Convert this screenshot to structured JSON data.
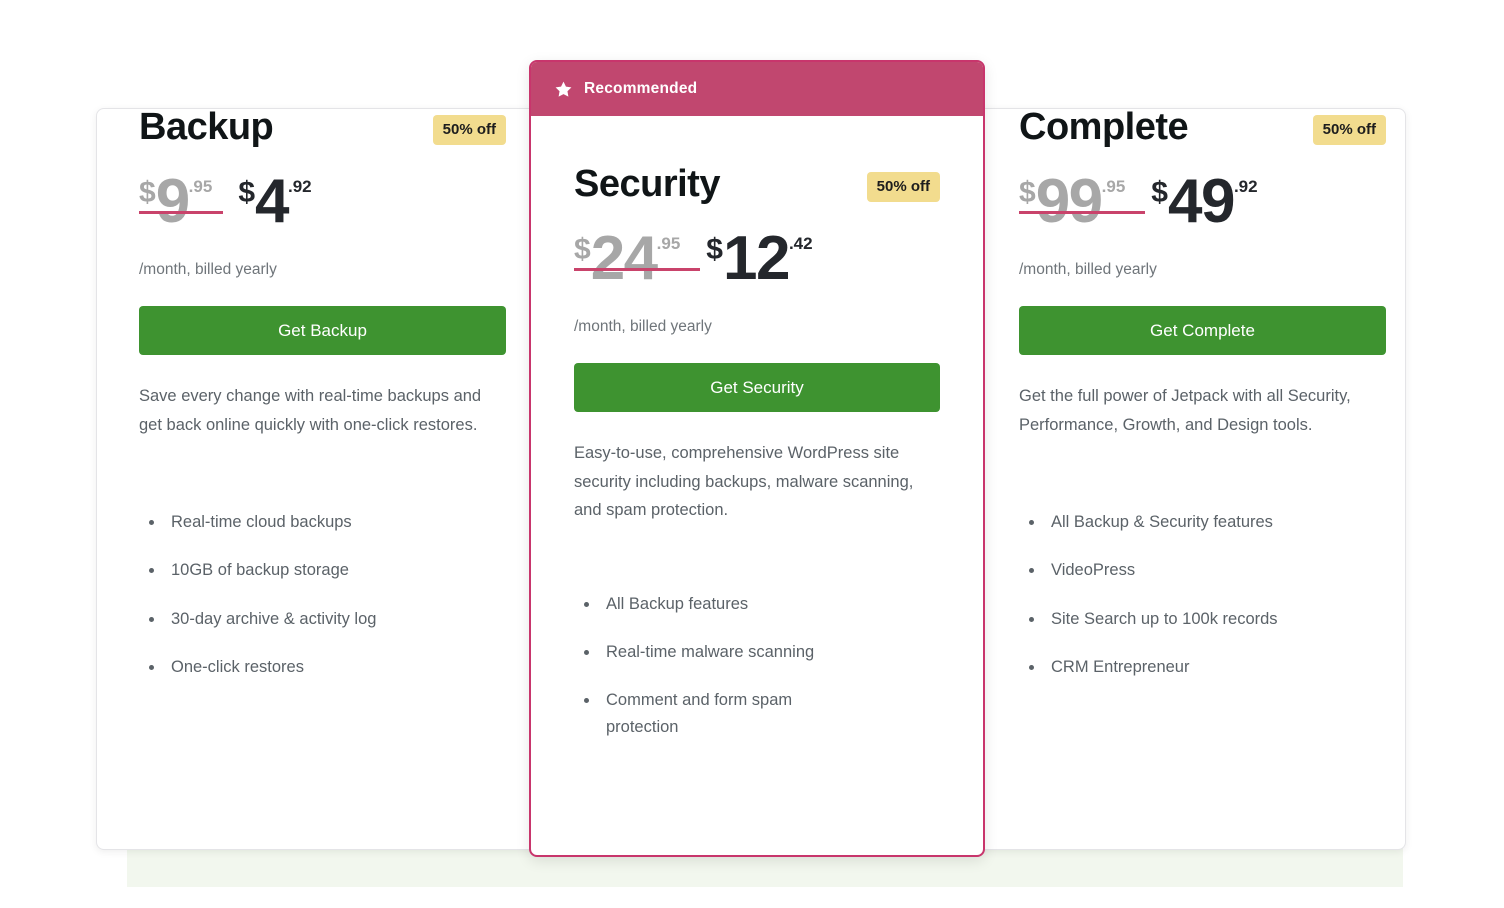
{
  "recommended_banner": {
    "label": "Recommended",
    "icon": "star-icon",
    "background_color": "#c1476f"
  },
  "theme": {
    "cta_green": "#3e9330",
    "badge_yellow": "#f2dc8e",
    "highlight_crimson": "#c8356c",
    "strike_color": "#c9436b",
    "band_green": "#f2f7ee"
  },
  "plans": [
    {
      "name": "Backup",
      "discount_badge": "50% off",
      "old_price": {
        "currency": "$",
        "integer": "9",
        "cents": ".95"
      },
      "new_price": {
        "currency": "$",
        "integer": "4",
        "cents": ".92"
      },
      "billing_note": "/month, billed yearly",
      "cta_label": "Get Backup",
      "description": "Save every change with real-time backups and get back online quickly with one-click restores.",
      "features": [
        "Real-time cloud backups",
        "10GB of backup storage",
        "30-day archive & activity log",
        "One-click restores"
      ]
    },
    {
      "name": "Security",
      "discount_badge": "50% off",
      "old_price": {
        "currency": "$",
        "integer": "24",
        "cents": ".95"
      },
      "new_price": {
        "currency": "$",
        "integer": "12",
        "cents": ".42"
      },
      "billing_note": "/month, billed yearly",
      "cta_label": "Get Security",
      "description": "Easy-to-use, comprehensive WordPress site security including backups, malware scanning, and spam protection.",
      "features": [
        "All Backup features",
        "Real-time malware scanning",
        "Comment and form spam protection"
      ]
    },
    {
      "name": "Complete",
      "discount_badge": "50% off",
      "old_price": {
        "currency": "$",
        "integer": "99",
        "cents": ".95"
      },
      "new_price": {
        "currency": "$",
        "integer": "49",
        "cents": ".92"
      },
      "billing_note": "/month, billed yearly",
      "cta_label": "Get Complete",
      "description": "Get the full power of Jetpack with all Security, Performance, Growth, and Design tools.",
      "features": [
        "All Backup & Security features",
        "VideoPress",
        "Site Search up to 100k records",
        "CRM Entrepreneur"
      ]
    }
  ]
}
